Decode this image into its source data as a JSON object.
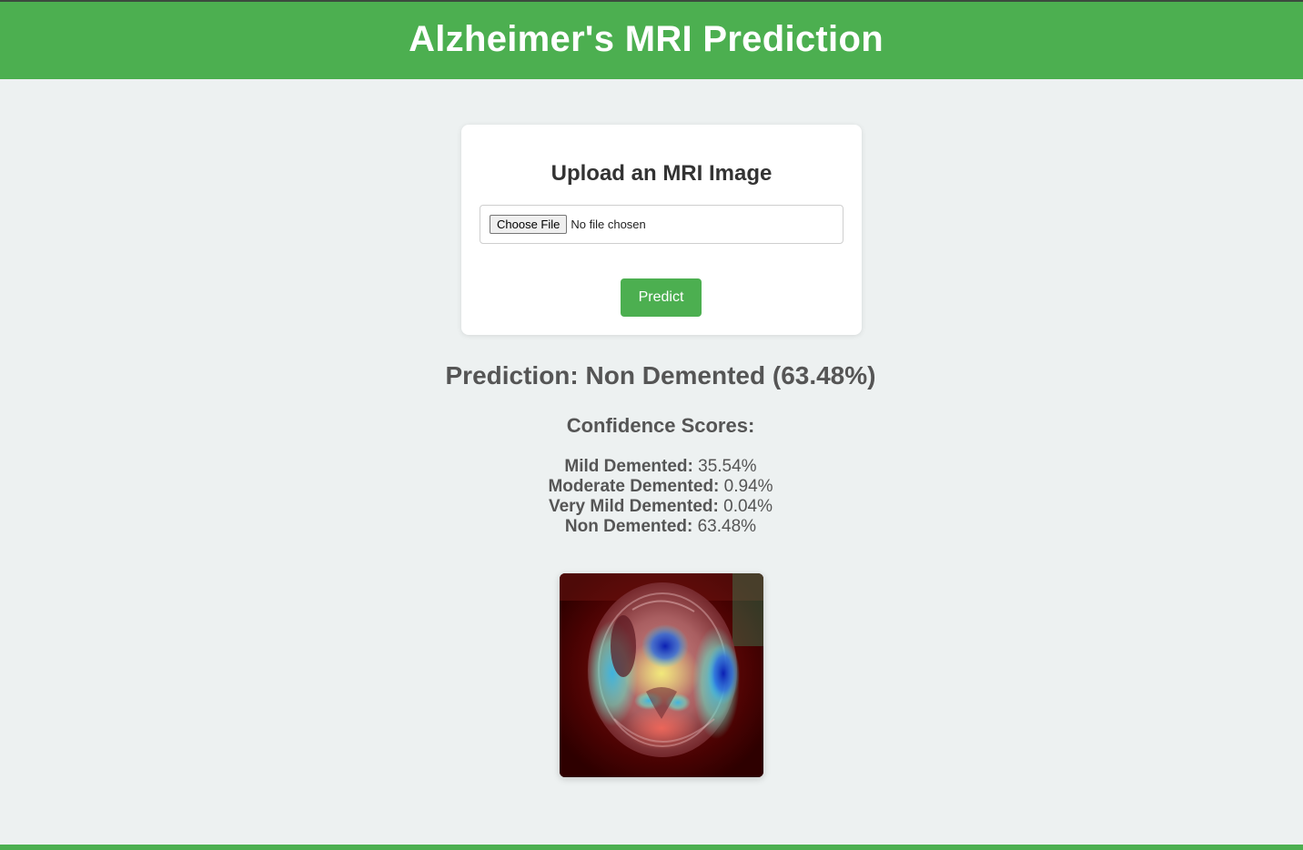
{
  "header": {
    "title": "Alzheimer's MRI Prediction"
  },
  "upload": {
    "heading": "Upload an MRI Image",
    "choose_label": "Choose File",
    "file_status": "No file chosen",
    "predict_label": "Predict"
  },
  "result": {
    "prediction_text": "Prediction: Non Demented (63.48%)",
    "confidence_title": "Confidence Scores:",
    "scores": [
      {
        "label": "Mild Demented:",
        "value": "35.54%"
      },
      {
        "label": "Moderate Demented:",
        "value": "0.94%"
      },
      {
        "label": "Very Mild Demented:",
        "value": "0.04%"
      },
      {
        "label": "Non Demented:",
        "value": "63.48%"
      }
    ]
  },
  "colors": {
    "accent": "#4caf50",
    "background": "#edf1f1",
    "text": "#555555"
  }
}
